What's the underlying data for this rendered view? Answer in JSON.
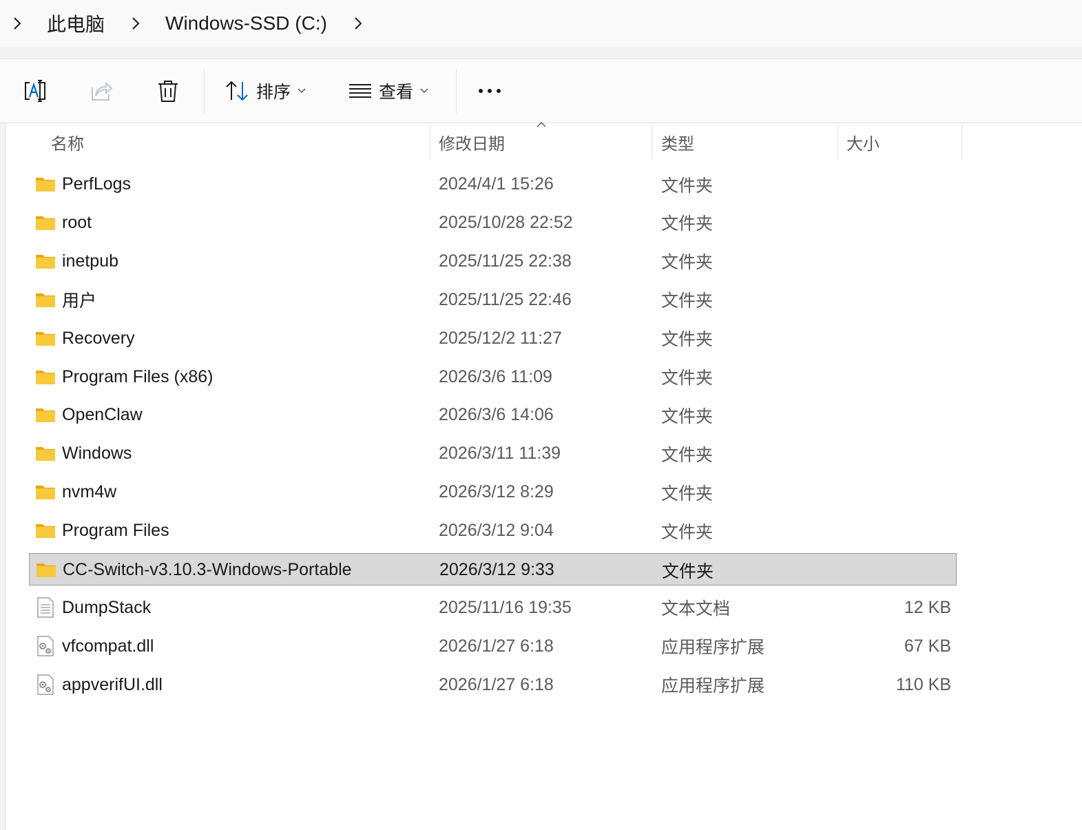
{
  "breadcrumb": {
    "items": [
      "此电脑",
      "Windows-SSD (C:)"
    ]
  },
  "toolbar": {
    "sort_label": "排序",
    "view_label": "查看"
  },
  "columns": {
    "name": "名称",
    "date": "修改日期",
    "type": "类型",
    "size": "大小"
  },
  "colors": {
    "folder": "#f4c430",
    "selected_bg": "#d9d9d9",
    "accent": "#0067c0"
  },
  "files": [
    {
      "name": "PerfLogs",
      "date": "2024/4/1 15:26",
      "type": "文件夹",
      "size": "",
      "icon": "folder-icon"
    },
    {
      "name": "root",
      "date": "2025/10/28 22:52",
      "type": "文件夹",
      "size": "",
      "icon": "folder-icon"
    },
    {
      "name": "inetpub",
      "date": "2025/11/25 22:38",
      "type": "文件夹",
      "size": "",
      "icon": "folder-icon"
    },
    {
      "name": "用户",
      "date": "2025/11/25 22:46",
      "type": "文件夹",
      "size": "",
      "icon": "folder-icon"
    },
    {
      "name": "Recovery",
      "date": "2025/12/2 11:27",
      "type": "文件夹",
      "size": "",
      "icon": "folder-icon"
    },
    {
      "name": "Program Files (x86)",
      "date": "2026/3/6 11:09",
      "type": "文件夹",
      "size": "",
      "icon": "folder-icon"
    },
    {
      "name": "OpenClaw",
      "date": "2026/3/6 14:06",
      "type": "文件夹",
      "size": "",
      "icon": "folder-icon"
    },
    {
      "name": "Windows",
      "date": "2026/3/11 11:39",
      "type": "文件夹",
      "size": "",
      "icon": "folder-icon"
    },
    {
      "name": "nvm4w",
      "date": "2026/3/12 8:29",
      "type": "文件夹",
      "size": "",
      "icon": "folder-icon"
    },
    {
      "name": "Program Files",
      "date": "2026/3/12 9:04",
      "type": "文件夹",
      "size": "",
      "icon": "folder-icon"
    },
    {
      "name": "CC-Switch-v3.10.3-Windows-Portable",
      "date": "2026/3/12 9:33",
      "type": "文件夹",
      "size": "",
      "icon": "folder-icon",
      "selected": true
    },
    {
      "name": "DumpStack",
      "date": "2025/11/16 19:35",
      "type": "文本文档",
      "size": "12 KB",
      "icon": "text-file-icon"
    },
    {
      "name": "vfcompat.dll",
      "date": "2026/1/27 6:18",
      "type": "应用程序扩展",
      "size": "67 KB",
      "icon": "dll-file-icon"
    },
    {
      "name": "appverifUI.dll",
      "date": "2026/1/27 6:18",
      "type": "应用程序扩展",
      "size": "110 KB",
      "icon": "dll-file-icon"
    }
  ]
}
